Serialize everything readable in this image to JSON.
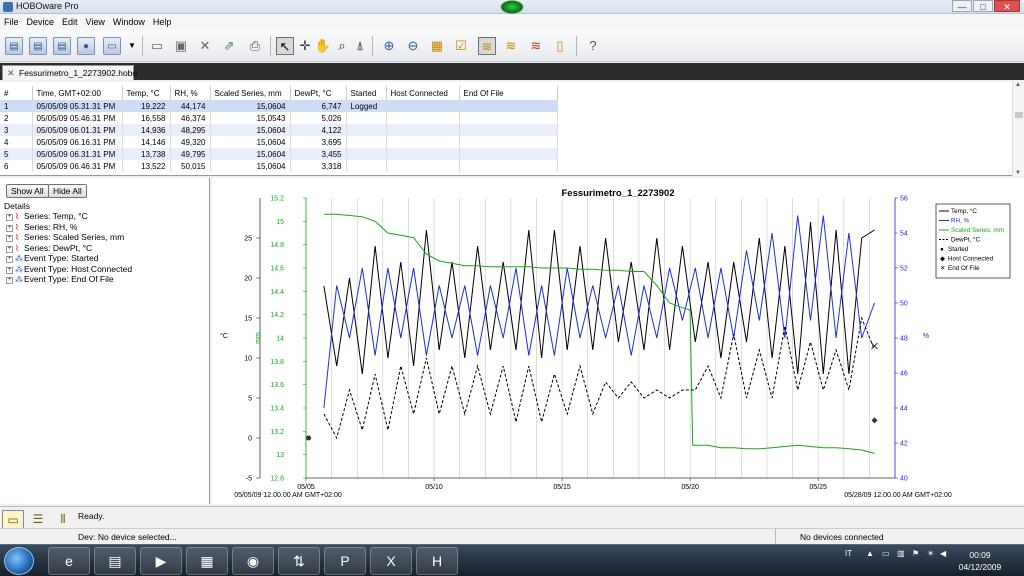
{
  "window": {
    "title": "HOBOware Pro",
    "controls": {
      "minimize": "—",
      "maximize": "□",
      "close": "✕"
    }
  },
  "menu": [
    "File",
    "Device",
    "Edit",
    "View",
    "Window",
    "Help"
  ],
  "toolbar": {
    "icons": [
      "launch-icon",
      "readout-icon",
      "status-icon",
      "stop-icon",
      "select-device-icon",
      "open-icon",
      "save-icon",
      "delete-icon",
      "export-icon",
      "print-icon",
      "pointer-icon",
      "crosshair-icon",
      "hand-icon",
      "magnifier-icon",
      "person-icon",
      "zoom-in-icon",
      "zoom-out-icon",
      "points-icon",
      "checklist-icon",
      "plot-active-icon",
      "plot2-icon",
      "plot3-icon",
      "thermometer-icon",
      "help-icon"
    ]
  },
  "document_tab": {
    "label": "Fessurimetro_1_2273902.hobo"
  },
  "table": {
    "columns": [
      "#",
      "Time, GMT+02:00",
      "Temp, °C",
      "RH, %",
      "Scaled Series, mm",
      "DewPt, °C",
      "Started",
      "Host Connected",
      "End Of File"
    ],
    "rows": [
      [
        "1",
        "05/05/09 05.31.31 PM",
        "19,222",
        "44,174",
        "15,0604",
        "6,747",
        "Logged",
        "",
        ""
      ],
      [
        "2",
        "05/05/09 05.46.31 PM",
        "16,558",
        "46,374",
        "15,0543",
        "5,026",
        "",
        "",
        ""
      ],
      [
        "3",
        "05/05/09 06.01.31 PM",
        "14,936",
        "48,295",
        "15,0604",
        "4,122",
        "",
        "",
        ""
      ],
      [
        "4",
        "05/05/09 06.16.31 PM",
        "14,146",
        "49,320",
        "15,0604",
        "3,695",
        "",
        "",
        ""
      ],
      [
        "5",
        "05/05/09 06.31.31 PM",
        "13,738",
        "49,795",
        "15,0604",
        "3,455",
        "",
        "",
        ""
      ],
      [
        "6",
        "05/05/09 06.46.31 PM",
        "13,522",
        "50,015",
        "15,0604",
        "3,318",
        "",
        "",
        ""
      ]
    ]
  },
  "left_panel": {
    "show_all": "Show All",
    "hide_all": "Hide All",
    "details_label": "Details",
    "items": [
      {
        "label": "Series: Temp, °C",
        "kind": "series"
      },
      {
        "label": "Series: RH, %",
        "kind": "series"
      },
      {
        "label": "Series: Scaled Series, mm",
        "kind": "series"
      },
      {
        "label": "Series: DewPt, °C",
        "kind": "series"
      },
      {
        "label": "Event Type: Started",
        "kind": "event"
      },
      {
        "label": "Event Type: Host Connected",
        "kind": "event"
      },
      {
        "label": "Event Type: End Of File",
        "kind": "event"
      }
    ]
  },
  "chart_data": {
    "type": "line",
    "title": "Fessurimetro_1_2273902",
    "x_ticks": [
      "05/05",
      "05/10",
      "05/15",
      "05/20",
      "05/25"
    ],
    "x_start_label": "05/05/09 12.00.00 AM GMT+02:00",
    "x_end_label": "05/28/09 12.00.00 AM GMT+02:00",
    "x_range_days": [
      0,
      23
    ],
    "left_axis_c": {
      "label": "°C",
      "ticks": [
        "-5",
        "0",
        "5",
        "10",
        "15",
        "20",
        "25"
      ],
      "range": [
        -5,
        30
      ]
    },
    "left_axis_mm": {
      "label": "mm",
      "ticks": [
        "12.8",
        "13",
        "13.2",
        "13.4",
        "13.6",
        "13.8",
        "14",
        "14.2",
        "14.4",
        "14.6",
        "14.8",
        "15",
        "15.2"
      ],
      "range": [
        12.8,
        15.2
      ]
    },
    "right_axis_rh": {
      "label": "%",
      "ticks": [
        "40",
        "42",
        "44",
        "46",
        "48",
        "50",
        "52",
        "54",
        "56"
      ],
      "range": [
        40,
        56
      ]
    },
    "grid": "vertical daily lines",
    "legend_position": "top-right",
    "legend": [
      {
        "name": "Temp, °C",
        "style": "black-solid"
      },
      {
        "name": "RH, %",
        "style": "blue-solid"
      },
      {
        "name": "Scaled Series, mm",
        "style": "green-solid"
      },
      {
        "name": "DewPt, °C",
        "style": "black-dashed"
      },
      {
        "name": "Started",
        "style": "dot"
      },
      {
        "name": "Host Connected",
        "style": "diamond"
      },
      {
        "name": "End Of File",
        "style": "cross"
      }
    ],
    "series": [
      {
        "name": "Temp, °C",
        "axis": "left_c",
        "color": "#000000",
        "x": [
          0.7,
          1.2,
          1.7,
          2.2,
          2.7,
          3.2,
          3.7,
          4.2,
          4.7,
          5.2,
          5.7,
          6.2,
          6.7,
          7.2,
          7.7,
          8.2,
          8.7,
          9.2,
          9.7,
          10.2,
          10.7,
          11.2,
          11.7,
          12.2,
          12.7,
          13.2,
          13.7,
          14.2,
          14.7,
          15.2,
          15.7,
          16.2,
          16.7,
          17.2,
          17.7,
          18.2,
          18.7,
          19.2,
          19.7,
          20.2,
          20.7,
          21.2,
          21.7,
          22.2
        ],
        "values": [
          19,
          9,
          20,
          8,
          24,
          10,
          22,
          9,
          26,
          11,
          22,
          10,
          24,
          11,
          22,
          11,
          26,
          10,
          26,
          11,
          24,
          11,
          25,
          12,
          22,
          11,
          25,
          11,
          24,
          12,
          22,
          10,
          22,
          12,
          25,
          10,
          24,
          8,
          27,
          8,
          26,
          8,
          25,
          26
        ]
      },
      {
        "name": "RH, %",
        "axis": "right_rh",
        "color": "#1f2fd6",
        "x": [
          0.7,
          1.2,
          1.7,
          2.2,
          2.7,
          3.2,
          3.7,
          4.2,
          4.7,
          5.2,
          5.7,
          6.2,
          6.7,
          7.2,
          7.7,
          8.2,
          8.7,
          9.2,
          9.7,
          10.2,
          10.7,
          11.2,
          11.7,
          12.2,
          12.7,
          13.2,
          13.7,
          14.2,
          14.7,
          15.2,
          15.7,
          16.2,
          16.7,
          17.2,
          17.7,
          18.2,
          18.7,
          19.2,
          19.7,
          20.2,
          20.7,
          21.2,
          21.7,
          22.2
        ],
        "values": [
          44,
          51,
          48,
          52,
          47,
          52,
          48,
          52,
          47,
          51,
          48,
          51,
          47,
          51,
          48,
          52,
          47,
          51,
          47,
          52,
          48,
          51,
          48,
          51,
          47,
          51,
          48,
          52,
          49,
          52,
          48,
          52,
          48,
          53,
          49,
          54,
          48,
          55,
          49,
          55,
          48,
          54,
          48,
          50
        ]
      },
      {
        "name": "Scaled Series, mm",
        "axis": "left_mm",
        "color": "#1aa51a",
        "x": [
          0.7,
          1.2,
          1.7,
          2.2,
          2.7,
          3.2,
          3.7,
          4.2,
          4.7,
          5.2,
          5.7,
          6.2,
          6.7,
          7.2,
          7.7,
          8.2,
          8.7,
          9.2,
          9.7,
          10.2,
          10.7,
          11.2,
          11.7,
          12.2,
          12.7,
          13.2,
          13.7,
          14.2,
          14.7,
          15.0,
          15.1,
          15.7,
          16.2,
          16.7,
          17.2,
          17.7,
          18.2,
          18.7,
          19.2,
          19.7,
          20.2,
          20.7,
          21.2,
          21.7,
          22.2
        ],
        "values": [
          15.06,
          15.06,
          15.05,
          15.04,
          15.0,
          14.9,
          14.88,
          14.86,
          14.72,
          14.66,
          14.64,
          14.62,
          14.62,
          14.61,
          14.61,
          14.61,
          14.61,
          14.6,
          14.6,
          14.6,
          14.59,
          14.59,
          14.58,
          14.58,
          14.57,
          14.57,
          14.45,
          14.3,
          14.26,
          14.24,
          13.08,
          13.08,
          13.06,
          13.06,
          13.05,
          13.05,
          13.06,
          13.07,
          13.08,
          13.07,
          13.06,
          13.06,
          13.05,
          13.04,
          13.01
        ]
      },
      {
        "name": "DewPt, °C",
        "axis": "left_c",
        "color": "#000000",
        "dashed": true,
        "x": [
          0.7,
          1.2,
          1.7,
          2.2,
          2.7,
          3.2,
          3.7,
          4.2,
          4.7,
          5.2,
          5.7,
          6.2,
          6.7,
          7.2,
          7.7,
          8.2,
          8.7,
          9.2,
          9.7,
          10.2,
          10.7,
          11.2,
          11.7,
          12.2,
          12.7,
          13.2,
          13.7,
          14.2,
          14.7,
          15.2,
          15.7,
          16.2,
          16.7,
          17.2,
          17.7,
          18.2,
          18.7,
          19.2,
          19.7,
          20.2,
          20.7,
          21.2,
          21.7,
          22.2
        ],
        "values": [
          3,
          0,
          6,
          1,
          8,
          1,
          9,
          3,
          10,
          3,
          9,
          3,
          9,
          3,
          9,
          2,
          9,
          2,
          8,
          3,
          9,
          3,
          7,
          5,
          7,
          5,
          6,
          5,
          6,
          6,
          9,
          5,
          13,
          5,
          11,
          5,
          14,
          6,
          12,
          6,
          11,
          6,
          15,
          11
        ]
      }
    ],
    "events": [
      {
        "name": "Started",
        "x": 0.1,
        "y_c": 0
      },
      {
        "name": "Host Connected",
        "x": 22.2,
        "y_c": 2.2
      },
      {
        "name": "End Of File",
        "x": 22.2,
        "y_c": 11.5
      }
    ]
  },
  "status": {
    "ready": "Ready.",
    "device": "Dev: No device selected...",
    "connected": "No devices connected"
  },
  "taskbar": {
    "tray_lang": "IT",
    "time": "00:09",
    "date": "04/12/2009"
  }
}
